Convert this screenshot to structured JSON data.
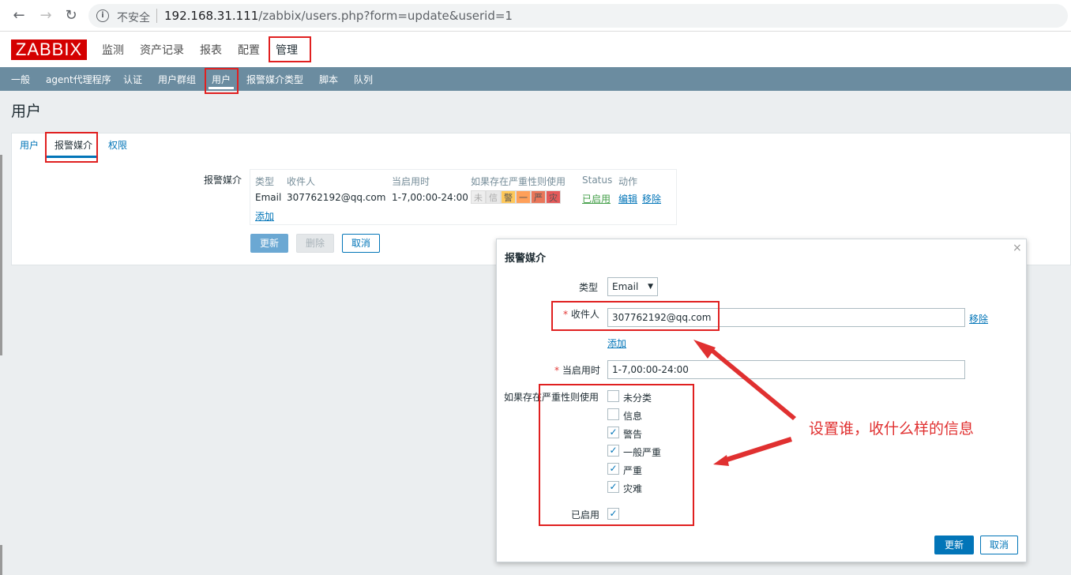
{
  "browser": {
    "insecure_label": "不安全",
    "url_host": "192.168.31.111",
    "url_path": "/zabbix/users.php?form=update&userid=1"
  },
  "logo": "ZABBIX",
  "main_menu": [
    "监测",
    "资产记录",
    "报表",
    "配置",
    "管理"
  ],
  "sub_menu": [
    "一般",
    "agent代理程序",
    "认证",
    "用户群组",
    "用户",
    "报警媒介类型",
    "脚本",
    "队列"
  ],
  "page_title": "用户",
  "tabs": [
    "用户",
    "报警媒介",
    "权限"
  ],
  "media": {
    "label": "报警媒介",
    "headers": [
      "类型",
      "收件人",
      "当启用时",
      "如果存在严重性则使用",
      "Status",
      "动作"
    ],
    "row": {
      "type": "Email",
      "recipient": "307762192@qq.com",
      "when_active": "1-7,00:00-24:00",
      "severities": [
        {
          "label": "未",
          "color": "#eeeeee"
        },
        {
          "label": "信",
          "color": "#e8e8e8"
        },
        {
          "label": "警",
          "color": "#ffc859"
        },
        {
          "label": "一",
          "color": "#ffa059"
        },
        {
          "label": "严",
          "color": "#e97659"
        },
        {
          "label": "灾",
          "color": "#e45959"
        }
      ],
      "status": "已启用",
      "edit": "编辑",
      "remove": "移除"
    },
    "add": "添加"
  },
  "form_buttons": {
    "update": "更新",
    "delete": "删除",
    "cancel": "取消"
  },
  "dialog": {
    "title": "报警媒介",
    "close": "×",
    "type_label": "类型",
    "type_value": "Email",
    "send_to_label": "收件人",
    "send_to_value": "307762192@qq.com",
    "remove": "移除",
    "add": "添加",
    "when_active_label": "当启用时",
    "when_active_value": "1-7,00:00-24:00",
    "severity_label": "如果存在严重性则使用",
    "severities": [
      {
        "label": "未分类",
        "checked": false
      },
      {
        "label": "信息",
        "checked": false
      },
      {
        "label": "警告",
        "checked": true
      },
      {
        "label": "一般严重",
        "checked": true
      },
      {
        "label": "严重",
        "checked": true
      },
      {
        "label": "灾难",
        "checked": true
      }
    ],
    "enabled_label": "已启用",
    "enabled_checked": true,
    "update": "更新",
    "cancel": "取消"
  },
  "annotation": "设置谁，收什么样的信息"
}
